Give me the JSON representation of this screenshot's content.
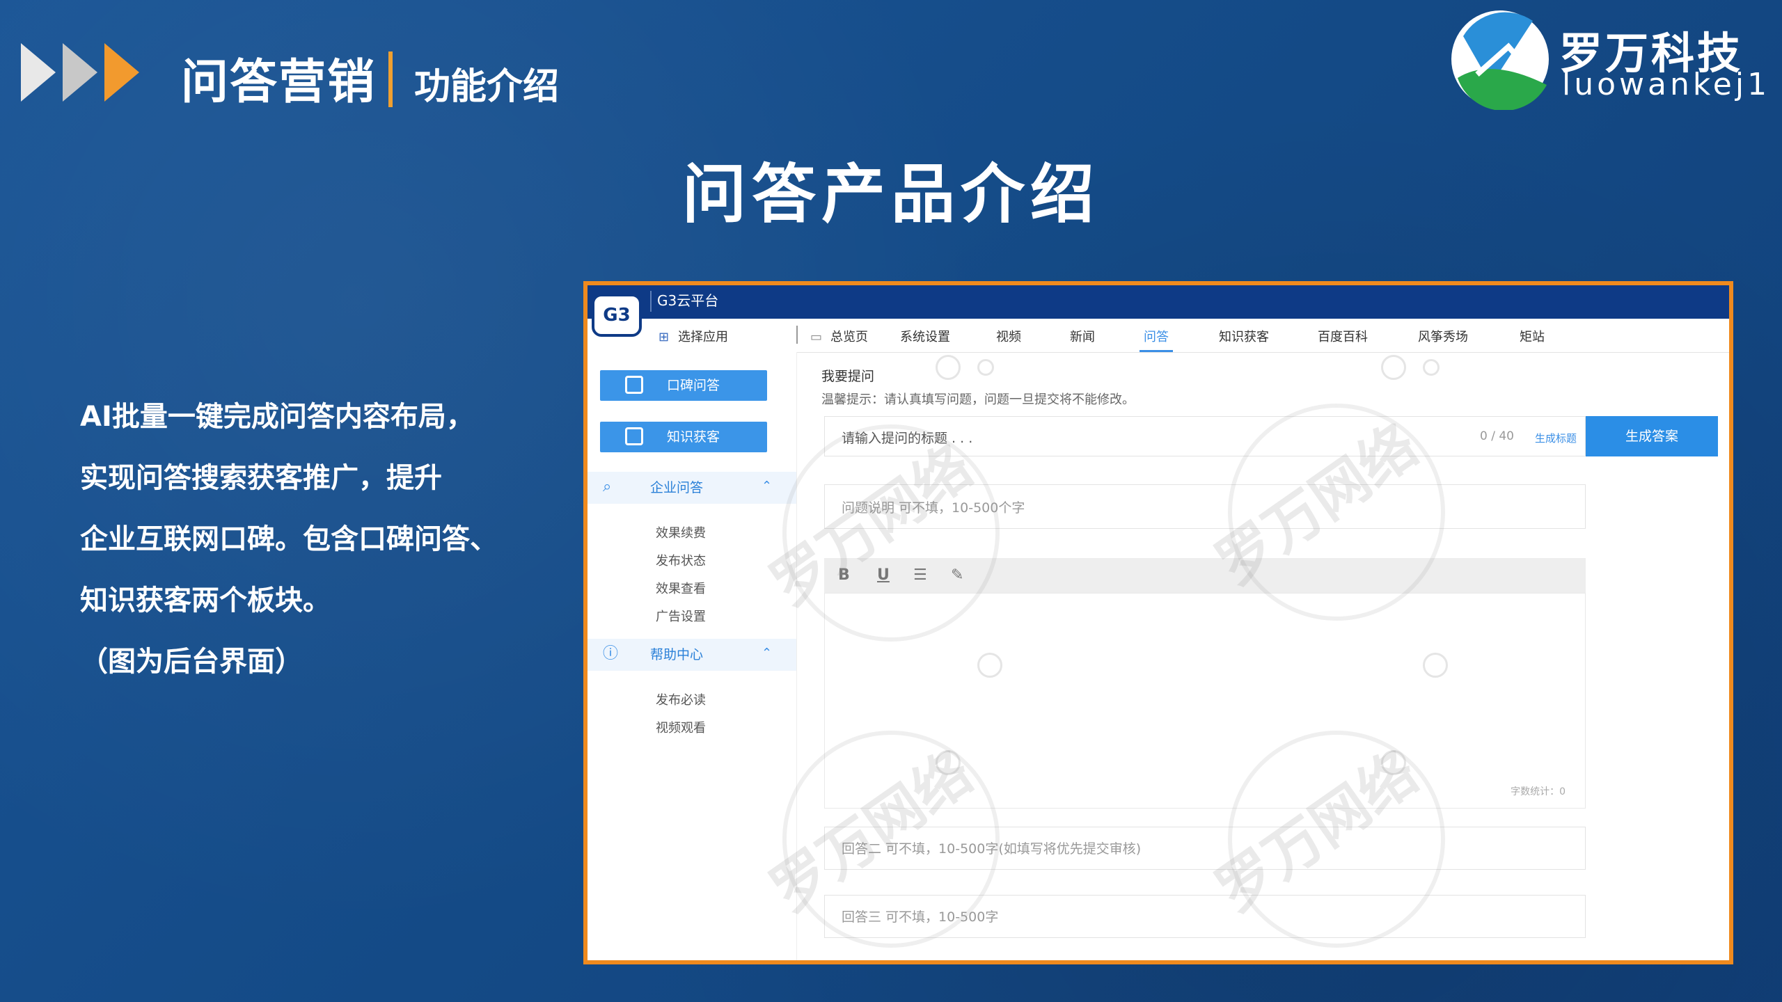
{
  "header": {
    "title": "问答营销",
    "subtitle": "功能介绍",
    "brand_cn": "罗万科技",
    "brand_en": "luowankej1"
  },
  "slide_title": "问答产品介绍",
  "description": [
    "AI批量一键完成问答内容布局，",
    "实现问答搜索获客推广，提升",
    "企业互联网口碑。包含口碑问答、",
    "知识获客两个板块。",
    "（图为后台界面）"
  ],
  "app": {
    "logo": "G3",
    "title": "G3云平台",
    "choose_app": "选择应用",
    "nav": [
      "总览页",
      "系统设置",
      "视频",
      "新闻",
      "问答",
      "知识获客",
      "百度百科",
      "风筝秀场",
      "矩站"
    ],
    "active_nav": "问答",
    "sidebar": {
      "buttons": [
        "口碑问答",
        "知识获客"
      ],
      "section1": "企业问答",
      "section1_items": [
        "效果续费",
        "发布状态",
        "效果查看",
        "广告设置"
      ],
      "section2": "帮助中心",
      "section2_items": [
        "发布必读",
        "视频观看"
      ]
    },
    "form": {
      "label": "我要提问",
      "tip": "温馨提示：请认真填写问题，问题一旦提交将不能修改。",
      "title_placeholder": "请输入提问的标题 . . .",
      "counter": "0 / 40",
      "gen_title": "生成标题",
      "gen_answer": "生成答案",
      "desc_placeholder": "问题说明 可不填，10-500个字",
      "toolbar": [
        "B",
        "U",
        "☰",
        "✎"
      ],
      "word_count": "字数统计：0",
      "answer2_placeholder": "回答二 可不填，10-500字(如填写将优先提交审核)",
      "answer3_placeholder": "回答三 可不填，10-500字"
    },
    "watermark": "罗万网络"
  },
  "colors": {
    "background": "#164d8c",
    "accent_orange": "#ef8a1e",
    "app_blue": "#0e3a86",
    "button_blue": "#3b95e8"
  }
}
